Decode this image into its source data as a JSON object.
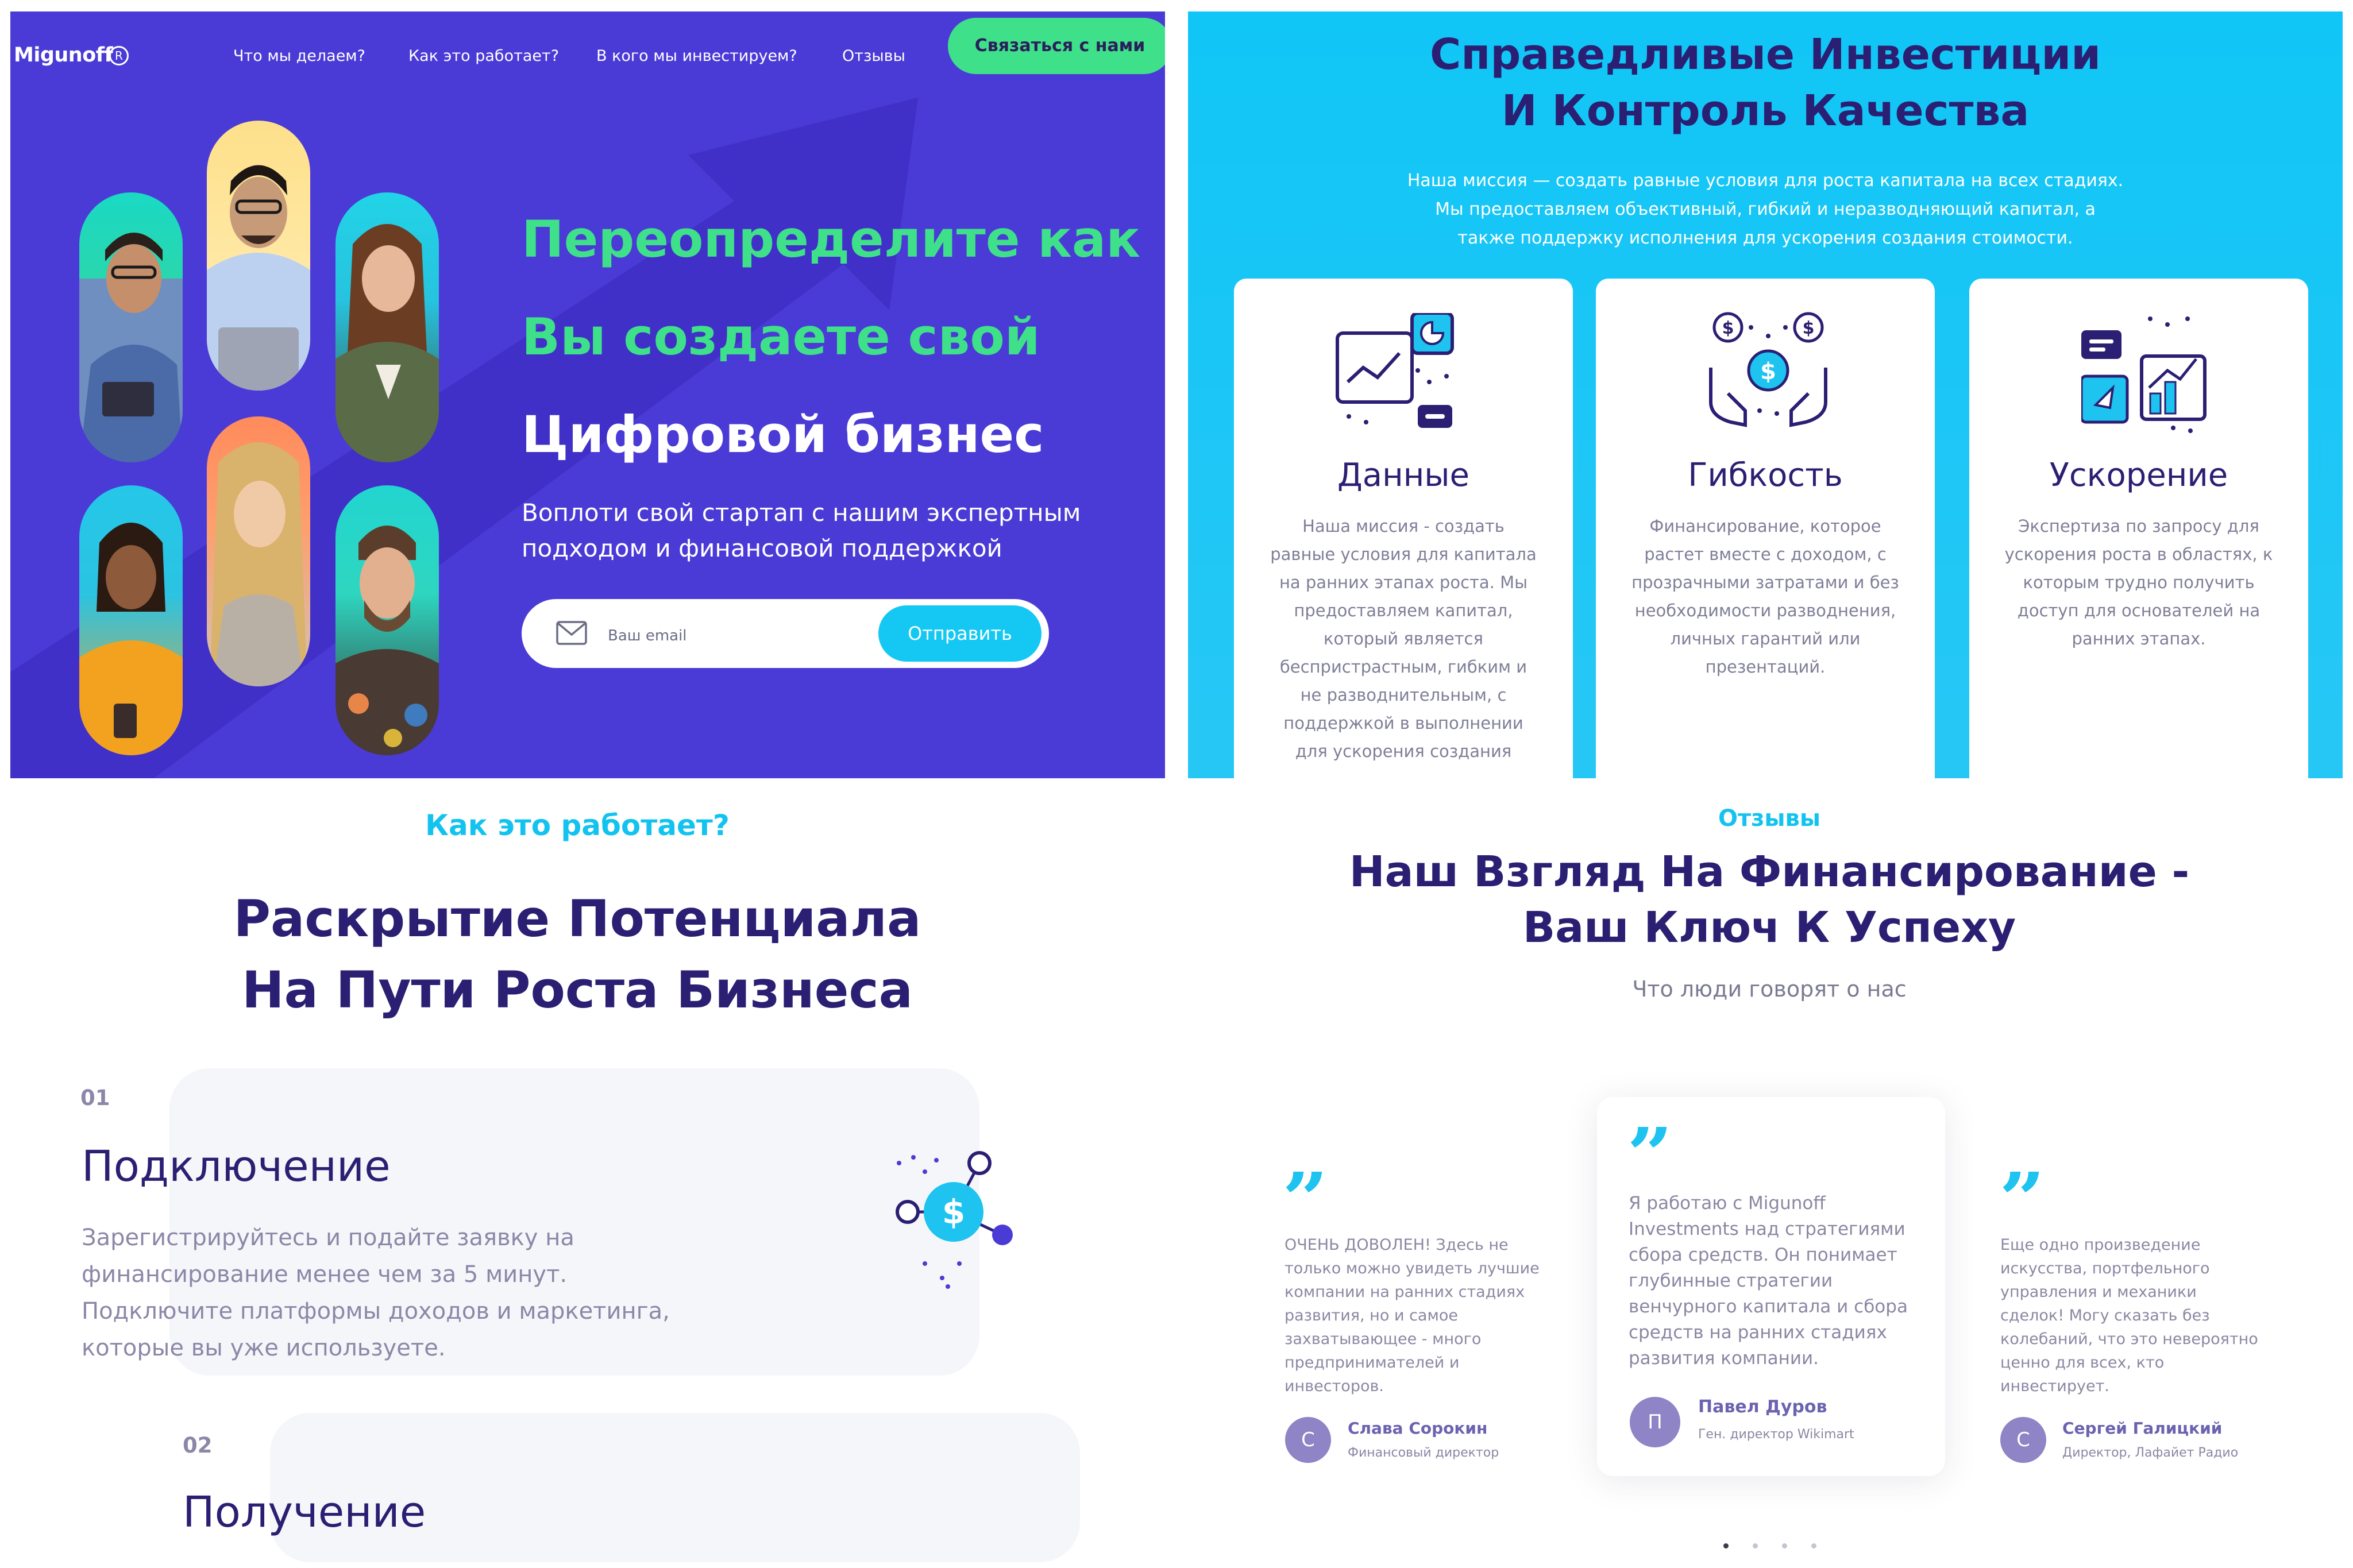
{
  "hero": {
    "logo": "Migunoff",
    "logo_mark": "R",
    "nav": [
      "Что мы делаем?",
      "Как это работает?",
      "В кого мы инвестируем?",
      "Отзывы"
    ],
    "contact_button": "Связаться с нами",
    "headline": [
      "Переопределите как",
      "Вы создаете свой",
      "Цифровой бизнес"
    ],
    "subheadline": "Воплоти свой стартап с нашим экспертным подходом и финансовой поддержкой",
    "email_placeholder": "Ваш email",
    "send_button": "Отправить",
    "colors": {
      "background": "#4b3bd6",
      "accent_green": "#3fe08a",
      "accent_cyan": "#14c8f3"
    }
  },
  "fair": {
    "title": [
      "Справедливые Инвестиции",
      "И Контроль Качества"
    ],
    "mission": [
      "Наша миссия — создать равные условия для роста капитала на всех стадиях.",
      "Мы предоставляем объективный, гибкий и неразводняющий капитал, а",
      "также поддержку исполнения для ускорения создания стоимости."
    ],
    "cards": [
      {
        "icon": "analytics-icon",
        "title": "Данные",
        "text": [
          "Наша миссия - создать",
          "равные условия для капитала",
          "на ранних этапах роста. Мы",
          "предоставляем капитал,",
          "который является",
          "беспристрастным, гибким и",
          "не разводнительным, с",
          "поддержкой в выполнении",
          "для ускорения создания"
        ]
      },
      {
        "icon": "hands-coins-icon",
        "title": "Гибкость",
        "text": [
          "Финансирование, которое",
          "растет вместе с доходом, с",
          "прозрачными затратами и без",
          "необходимости разводнения,",
          "личных гарантий или",
          "презентаций."
        ]
      },
      {
        "icon": "growth-chart-icon",
        "title": "Ускорение",
        "text": [
          "Экспертиза по запросу для",
          "ускорения роста в областях, к",
          "которым трудно получить",
          "доступ для основателей на",
          "ранних этапах."
        ]
      }
    ],
    "colors": {
      "background": "#10c6f6",
      "title": "#2b1f73"
    }
  },
  "how": {
    "kicker": "Как это работает?",
    "title": [
      "Раскрытие Потенциала",
      "На Пути Роста Бизнеса"
    ],
    "steps": [
      {
        "num": "01",
        "title": "Подключение",
        "text": [
          "Зарегистрируйтесь и подайте заявку на",
          "финансирование менее чем за 5 минут.",
          "Подключите платформы доходов и маркетинга,",
          "которые вы уже используете."
        ]
      },
      {
        "num": "02",
        "title": "Получение"
      }
    ]
  },
  "reviews": {
    "kicker": "Отзывы",
    "title": [
      "Наш Взгляд На Финансирование -",
      "Ваш Ключ К Успеху"
    ],
    "subtitle": "Что люди говорят о нас",
    "items": [
      {
        "text": [
          "ОЧЕНЬ ДОВОЛЕН! Здесь не",
          "только можно увидеть лучшие",
          "компании на ранних стадиях",
          "развития, но и самое",
          "захватывающее - много",
          "предпринимателей и",
          "инвесторов."
        ],
        "initial": "С",
        "name": "Слава Сорокин",
        "role": "Финансовый директор"
      },
      {
        "text": [
          "Я работаю с Migunoff",
          "Investments над стратегиями",
          "сбора средств. Он понимает",
          "глубинные стратегии",
          "венчурного капитала и сбора",
          "средств на ранних стадиях",
          "развития компании."
        ],
        "initial": "П",
        "name": "Павел Дуров",
        "role": "Ген. директор Wikimart"
      },
      {
        "text": [
          "Еще одно произведение",
          "искусства, портфельного",
          "управления и механики",
          "сделок! Могу сказать без",
          "колебаний, что это невероятно",
          "ценно для всех, кто",
          "инвестирует."
        ],
        "initial": "С",
        "name": "Сергей Галицкий",
        "role": "Директор, Лафайет Радио"
      }
    ]
  }
}
